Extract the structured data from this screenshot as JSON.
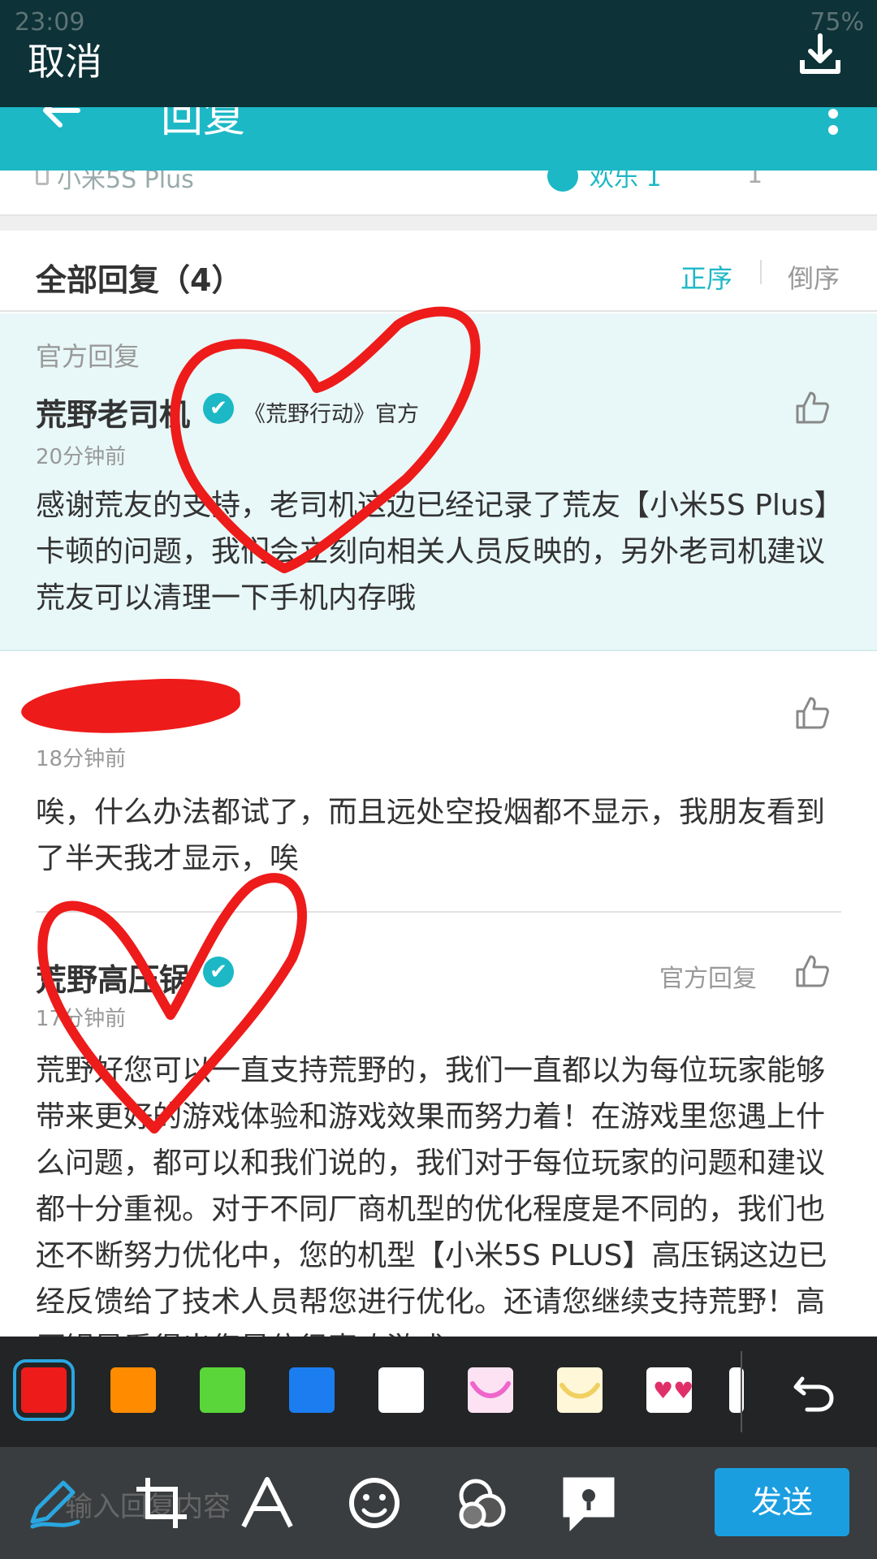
{
  "status_bar": {
    "time": "23:09",
    "battery": "75%"
  },
  "edit_bar": {
    "cancel_label": "取消",
    "download_icon": "download-icon"
  },
  "nav": {
    "title": "回复",
    "back_icon": "back-arrow-icon",
    "more_icon": "more-vert-icon"
  },
  "device_row": {
    "device": "小米5S Plus",
    "fun_label": "欢乐 1",
    "like_count": "1"
  },
  "replies": {
    "title": "全部回复（4）",
    "sort_asc": "正序",
    "sort_desc": "倒序"
  },
  "official_reply": {
    "tag": "官方回复",
    "author": "荒野老司机",
    "author_title": "《荒野行动》官方",
    "time": "20分钟前",
    "text": "感谢荒友的支持，老司机这边已经记录了荒友【小米5S Plus】卡顿的问题，我们会立刻向相关人员反映的，另外老司机建议荒友可以清理一下手机内存哦"
  },
  "reply_2": {
    "time": "18分钟前",
    "text": "唉，什么办法都试了，而且远处空投烟都不显示，我朋友看到了半天我才显示，唉"
  },
  "reply_3": {
    "author": "荒野高压锅",
    "official_mark": "官方回复",
    "time": "17分钟前",
    "text": "荒野好您可以一直支持荒野的，我们一直都以为每位玩家能够带来更好的游戏体验和游戏效果而努力着！在游戏里您遇上什么问题，都可以和我们说的，我们对于每位玩家的问题和建议都十分重视。对于不同厂商机型的优化程度是不同的，我们也还不断努力优化中，您的机型【小米5S PLUS】高压锅这边已经反馈给了技术人员帮您进行优化。还请您继续支持荒野！高压锅是看得出您是位很喜欢游戏"
  },
  "picker": {
    "colors": [
      "#ee1b1b",
      "#ff8c00",
      "#5ad63a",
      "#1c7df0",
      "#ffffff"
    ],
    "selected": "#ee1b1b"
  },
  "toolbar": {
    "placeholder": "输入回复内容",
    "send_label": "发送"
  }
}
